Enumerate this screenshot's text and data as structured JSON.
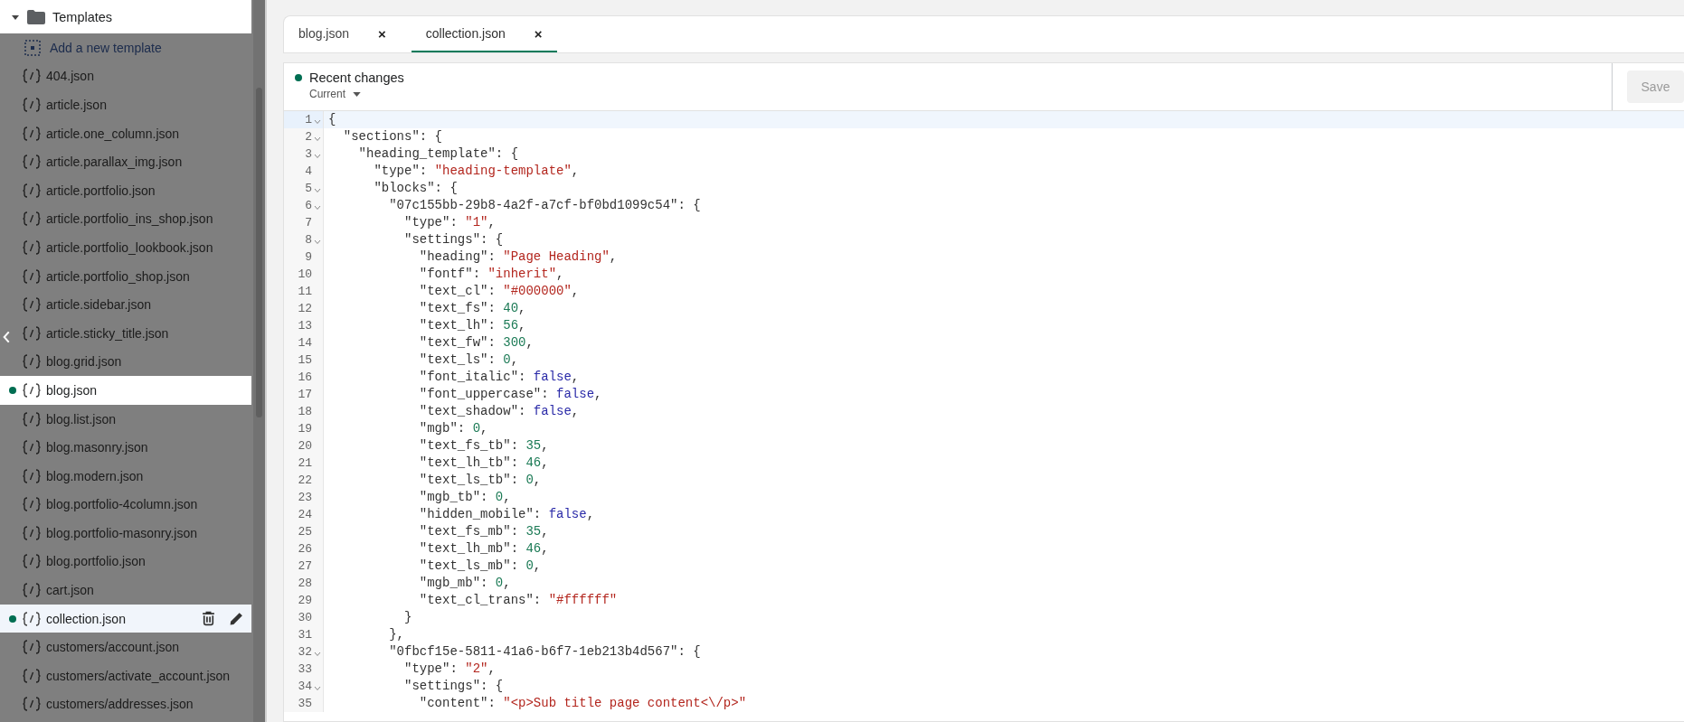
{
  "sidebar": {
    "folder": {
      "label": "Templates",
      "expanded": true
    },
    "add_action": "Add a new template",
    "items": [
      {
        "label": "404.json",
        "highlighted": false,
        "modified": false,
        "selected": false
      },
      {
        "label": "article.json",
        "highlighted": false,
        "modified": false,
        "selected": false
      },
      {
        "label": "article.one_column.json",
        "highlighted": false,
        "modified": false,
        "selected": false
      },
      {
        "label": "article.parallax_img.json",
        "highlighted": false,
        "modified": false,
        "selected": false
      },
      {
        "label": "article.portfolio.json",
        "highlighted": false,
        "modified": false,
        "selected": false
      },
      {
        "label": "article.portfolio_ins_shop.json",
        "highlighted": false,
        "modified": false,
        "selected": false
      },
      {
        "label": "article.portfolio_lookbook.json",
        "highlighted": false,
        "modified": false,
        "selected": false
      },
      {
        "label": "article.portfolio_shop.json",
        "highlighted": false,
        "modified": false,
        "selected": false
      },
      {
        "label": "article.sidebar.json",
        "highlighted": false,
        "modified": false,
        "selected": false
      },
      {
        "label": "article.sticky_title.json",
        "highlighted": false,
        "modified": false,
        "selected": false
      },
      {
        "label": "blog.grid.json",
        "highlighted": false,
        "modified": false,
        "selected": false
      },
      {
        "label": "blog.json",
        "highlighted": true,
        "modified": true,
        "selected": false
      },
      {
        "label": "blog.list.json",
        "highlighted": false,
        "modified": false,
        "selected": false
      },
      {
        "label": "blog.masonry.json",
        "highlighted": false,
        "modified": false,
        "selected": false
      },
      {
        "label": "blog.modern.json",
        "highlighted": false,
        "modified": false,
        "selected": false
      },
      {
        "label": "blog.portfolio-4column.json",
        "highlighted": false,
        "modified": false,
        "selected": false
      },
      {
        "label": "blog.portfolio-masonry.json",
        "highlighted": false,
        "modified": false,
        "selected": false
      },
      {
        "label": "blog.portfolio.json",
        "highlighted": false,
        "modified": false,
        "selected": false
      },
      {
        "label": "cart.json",
        "highlighted": false,
        "modified": false,
        "selected": false
      },
      {
        "label": "collection.json",
        "highlighted": true,
        "modified": true,
        "selected": true
      },
      {
        "label": "customers/account.json",
        "highlighted": false,
        "modified": false,
        "selected": false
      },
      {
        "label": "customers/activate_account.json",
        "highlighted": false,
        "modified": false,
        "selected": false
      },
      {
        "label": "customers/addresses.json",
        "highlighted": false,
        "modified": false,
        "selected": false
      }
    ]
  },
  "tabs": [
    {
      "label": "blog.json",
      "close": "×",
      "selected": false
    },
    {
      "label": "collection.json",
      "close": "×",
      "selected": true
    }
  ],
  "header": {
    "title": "Recent changes",
    "modified": true,
    "version": "Current",
    "save": {
      "label": "Save",
      "disabled": true
    }
  },
  "editor": {
    "lines": [
      {
        "number": "1",
        "fold": true,
        "active": true,
        "code": "{"
      },
      {
        "number": "2",
        "fold": true,
        "active": false,
        "code": "  \"sections\": {"
      },
      {
        "number": "3",
        "fold": true,
        "active": false,
        "code": "    \"heading_template\": {"
      },
      {
        "number": "4",
        "fold": false,
        "active": false,
        "code": "      \"type\": ",
        "value": "\"heading-template\"",
        "kind": "string",
        "tail": ","
      },
      {
        "number": "5",
        "fold": true,
        "active": false,
        "code": "      \"blocks\": {"
      },
      {
        "number": "6",
        "fold": true,
        "active": false,
        "code": "        \"07c155bb-29b8-4a2f-a7cf-bf0bd1099c54\": {"
      },
      {
        "number": "7",
        "fold": false,
        "active": false,
        "code": "          \"type\": ",
        "value": "\"1\"",
        "kind": "string",
        "tail": ","
      },
      {
        "number": "8",
        "fold": true,
        "active": false,
        "code": "          \"settings\": {"
      },
      {
        "number": "9",
        "fold": false,
        "active": false,
        "code": "            \"heading\": ",
        "value": "\"Page Heading\"",
        "kind": "string",
        "tail": ","
      },
      {
        "number": "10",
        "fold": false,
        "active": false,
        "code": "            \"fontf\": ",
        "value": "\"inherit\"",
        "kind": "string",
        "tail": ","
      },
      {
        "number": "11",
        "fold": false,
        "active": false,
        "code": "            \"text_cl\": ",
        "value": "\"#000000\"",
        "kind": "string",
        "tail": ","
      },
      {
        "number": "12",
        "fold": false,
        "active": false,
        "code": "            \"text_fs\": ",
        "value": "40",
        "kind": "number",
        "tail": ","
      },
      {
        "number": "13",
        "fold": false,
        "active": false,
        "code": "            \"text_lh\": ",
        "value": "56",
        "kind": "number",
        "tail": ","
      },
      {
        "number": "14",
        "fold": false,
        "active": false,
        "code": "            \"text_fw\": ",
        "value": "300",
        "kind": "number",
        "tail": ","
      },
      {
        "number": "15",
        "fold": false,
        "active": false,
        "code": "            \"text_ls\": ",
        "value": "0",
        "kind": "number",
        "tail": ","
      },
      {
        "number": "16",
        "fold": false,
        "active": false,
        "code": "            \"font_italic\": ",
        "value": "false",
        "kind": "atom",
        "tail": ","
      },
      {
        "number": "17",
        "fold": false,
        "active": false,
        "code": "            \"font_uppercase\": ",
        "value": "false",
        "kind": "atom",
        "tail": ","
      },
      {
        "number": "18",
        "fold": false,
        "active": false,
        "code": "            \"text_shadow\": ",
        "value": "false",
        "kind": "atom",
        "tail": ","
      },
      {
        "number": "19",
        "fold": false,
        "active": false,
        "code": "            \"mgb\": ",
        "value": "0",
        "kind": "number",
        "tail": ","
      },
      {
        "number": "20",
        "fold": false,
        "active": false,
        "code": "            \"text_fs_tb\": ",
        "value": "35",
        "kind": "number",
        "tail": ","
      },
      {
        "number": "21",
        "fold": false,
        "active": false,
        "code": "            \"text_lh_tb\": ",
        "value": "46",
        "kind": "number",
        "tail": ","
      },
      {
        "number": "22",
        "fold": false,
        "active": false,
        "code": "            \"text_ls_tb\": ",
        "value": "0",
        "kind": "number",
        "tail": ","
      },
      {
        "number": "23",
        "fold": false,
        "active": false,
        "code": "            \"mgb_tb\": ",
        "value": "0",
        "kind": "number",
        "tail": ","
      },
      {
        "number": "24",
        "fold": false,
        "active": false,
        "code": "            \"hidden_mobile\": ",
        "value": "false",
        "kind": "atom",
        "tail": ","
      },
      {
        "number": "25",
        "fold": false,
        "active": false,
        "code": "            \"text_fs_mb\": ",
        "value": "35",
        "kind": "number",
        "tail": ","
      },
      {
        "number": "26",
        "fold": false,
        "active": false,
        "code": "            \"text_lh_mb\": ",
        "value": "46",
        "kind": "number",
        "tail": ","
      },
      {
        "number": "27",
        "fold": false,
        "active": false,
        "code": "            \"text_ls_mb\": ",
        "value": "0",
        "kind": "number",
        "tail": ","
      },
      {
        "number": "28",
        "fold": false,
        "active": false,
        "code": "            \"mgb_mb\": ",
        "value": "0",
        "kind": "number",
        "tail": ","
      },
      {
        "number": "29",
        "fold": false,
        "active": false,
        "code": "            \"text_cl_trans\": ",
        "value": "\"#ffffff\"",
        "kind": "string"
      },
      {
        "number": "30",
        "fold": false,
        "active": false,
        "code": "          }"
      },
      {
        "number": "31",
        "fold": false,
        "active": false,
        "code": "        },"
      },
      {
        "number": "32",
        "fold": true,
        "active": false,
        "code": "        \"0fbcf15e-5811-41a6-b6f7-1eb213b4d567\": {"
      },
      {
        "number": "33",
        "fold": false,
        "active": false,
        "code": "          \"type\": ",
        "value": "\"2\"",
        "kind": "string",
        "tail": ","
      },
      {
        "number": "34",
        "fold": true,
        "active": false,
        "code": "          \"settings\": {"
      },
      {
        "number": "35",
        "fold": false,
        "active": false,
        "code": "            \"content\": ",
        "value": "\"<p>Sub title page content<\\/p>\"",
        "kind": "string"
      }
    ]
  }
}
